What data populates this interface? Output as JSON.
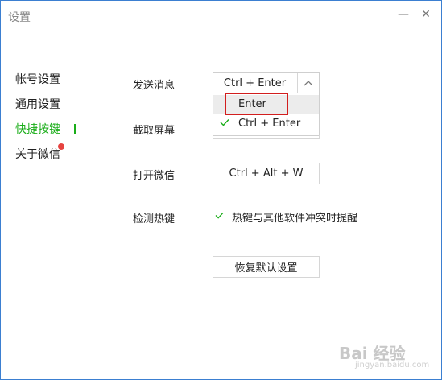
{
  "window": {
    "title": "设置",
    "minimize_glyph": "—",
    "close_glyph": "✕"
  },
  "sidebar": {
    "items": [
      {
        "label": "帐号设置"
      },
      {
        "label": "通用设置"
      },
      {
        "label": "快捷按键",
        "active": true
      },
      {
        "label": "关于微信",
        "badge": "red-dot"
      }
    ]
  },
  "shortcuts": {
    "send_message": {
      "label": "发送消息",
      "value": "Ctrl + Enter",
      "options": [
        {
          "label": "Enter",
          "highlighted": true
        },
        {
          "label": "Ctrl + Enter",
          "checked": true
        }
      ]
    },
    "screenshot": {
      "label": "截取屏幕"
    },
    "open_wechat": {
      "label": "打开微信",
      "value": "Ctrl + Alt + W"
    },
    "detect_hotkey": {
      "label": "检测热键",
      "checkbox_label": "热键与其他软件冲突时提醒",
      "checked": true
    }
  },
  "restore_defaults_label": "恢复默认设置",
  "watermark": {
    "logo": "Bai 经验",
    "url": "jingyan.baidu.com"
  },
  "colors": {
    "accent": "#1aad19",
    "highlight_border": "#d21e1e",
    "badge": "#e64340",
    "window_border": "#3b7fd1"
  },
  "icons": {
    "check": "check-icon",
    "select_arrow": "chevron-up-icon"
  }
}
